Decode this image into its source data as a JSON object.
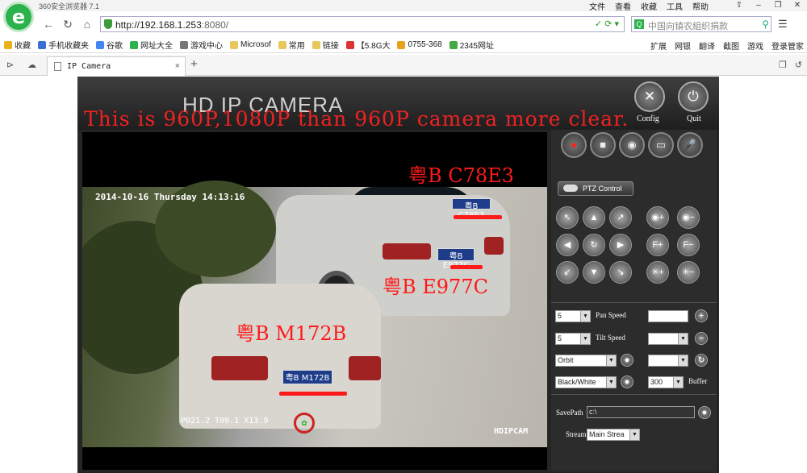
{
  "browser": {
    "app_title": "360安全浏览器 7.1",
    "logo_glyph": "e",
    "menu": [
      "文件",
      "查看",
      "收藏",
      "工具",
      "帮助"
    ],
    "window_controls": [
      "⇧",
      "–",
      "❐",
      "✕"
    ],
    "nav": {
      "back": "←",
      "forward": "↻",
      "home": "⌂",
      "menu": "☰"
    },
    "url_host": "http://192.168.1.253",
    "url_port": ":8080/",
    "search_placeholder": "中国向镇农組织捐款",
    "search_engine_glyph": "Q",
    "bookmarks": [
      {
        "label": "收藏",
        "color": "#e8b21b"
      },
      {
        "label": "手机收藏夹",
        "color": "#3b6fd1"
      },
      {
        "label": "谷歌",
        "color": "#4285f4"
      },
      {
        "label": "网址大全",
        "color": "#2bb24c"
      },
      {
        "label": "游戏中心",
        "color": "#777"
      },
      {
        "label": "Microsof",
        "color": "#e8c75b"
      },
      {
        "label": "常用",
        "color": "#e8c75b"
      },
      {
        "label": "链接",
        "color": "#e8c75b"
      },
      {
        "label": "【5.8G大",
        "color": "#d33"
      },
      {
        "label": "0755-368",
        "color": "#e8a21b"
      },
      {
        "label": "2345网址",
        "color": "#4a4"
      }
    ],
    "bookmarks_right": [
      "扩展",
      "网银",
      "翻译",
      "截图",
      "游戏",
      "登录管家"
    ],
    "tab": {
      "label": "IP Camera",
      "close": "×",
      "new": "+"
    }
  },
  "camera": {
    "title": "HD IP CAMERA",
    "overlay_text": "This is 960P,1080P than 960P camera more clear.",
    "config_label": "Config",
    "quit_label": "Quit",
    "osd_time": "2014-10-16 Thursday 14:13:16",
    "osd_bottom": "P021.2 T09.1 X13.9",
    "osd_brand": "HDIPCAM",
    "plates": [
      {
        "caption": "粤B C78E3",
        "plate": "粤B C78E3"
      },
      {
        "caption": "粤B E977C",
        "plate": "粤B E977C"
      },
      {
        "caption": "粤B M172B",
        "plate": "粤B M172B"
      }
    ],
    "controls": [
      "●",
      "■",
      "◉",
      "▭",
      "🎤"
    ],
    "ptz_label": "PTZ Control",
    "directions": [
      "↖",
      "▲",
      "↗",
      "◀",
      "↻",
      "▶",
      "↙",
      "▼",
      "↘"
    ],
    "lens": [
      "◉+",
      "◉−",
      "F+",
      "F−",
      "✳+",
      "✳−"
    ],
    "pan_speed": {
      "value": "5",
      "label": "Pan Speed"
    },
    "tilt_speed": {
      "value": "5",
      "label": "Tilt Speed"
    },
    "orbit": {
      "value": "Orbit"
    },
    "color_mode": {
      "value": "Black/White"
    },
    "buffer": {
      "value": "300",
      "label": "Buffer"
    },
    "save_path": {
      "label": "SavePath",
      "value": "c:\\"
    },
    "stream": {
      "label": "Stream",
      "value": "Main Strea"
    }
  }
}
